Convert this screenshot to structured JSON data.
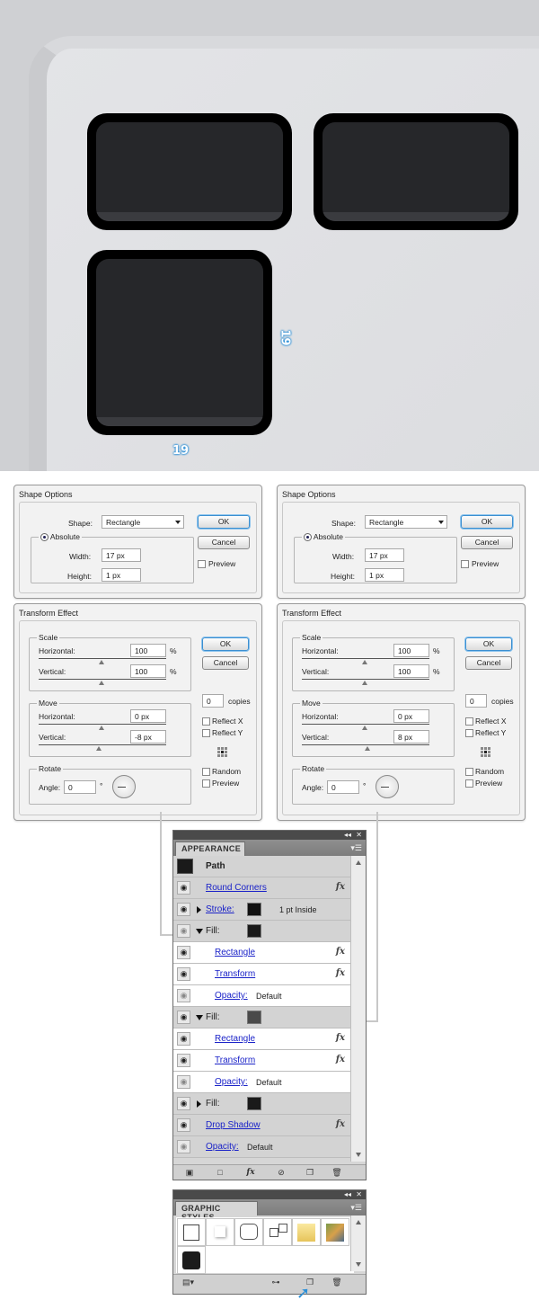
{
  "canvas": {
    "dimension_right": "19",
    "dimension_bottom": "19"
  },
  "shape_options_left": {
    "title": "Shape Options",
    "shape_label": "Shape:",
    "shape_value": "Rectangle",
    "absolute_label": "Absolute",
    "width_label": "Width:",
    "width_value": "17 px",
    "height_label": "Height:",
    "height_value": "1 px",
    "ok": "OK",
    "cancel": "Cancel",
    "preview": "Preview"
  },
  "shape_options_right": {
    "title": "Shape Options",
    "shape_label": "Shape:",
    "shape_value": "Rectangle",
    "absolute_label": "Absolute",
    "width_label": "Width:",
    "width_value": "17 px",
    "height_label": "Height:",
    "height_value": "1 px",
    "ok": "OK",
    "cancel": "Cancel",
    "preview": "Preview"
  },
  "transform_left": {
    "title": "Transform Effect",
    "scale_legend": "Scale",
    "horizontal_label": "Horizontal:",
    "scale_h_value": "100",
    "vertical_label": "Vertical:",
    "scale_v_value": "100",
    "percent": "%",
    "move_legend": "Move",
    "move_h_value": "0 px",
    "move_v_value": "-8 px",
    "rotate_legend": "Rotate",
    "angle_label": "Angle:",
    "angle_value": "0",
    "degree": "°",
    "ok": "OK",
    "cancel": "Cancel",
    "copies_value": "0",
    "copies_label": "copies",
    "reflect_x": "Reflect X",
    "reflect_y": "Reflect Y",
    "random": "Random",
    "preview": "Preview"
  },
  "transform_right": {
    "title": "Transform Effect",
    "scale_legend": "Scale",
    "horizontal_label": "Horizontal:",
    "scale_h_value": "100",
    "vertical_label": "Vertical:",
    "scale_v_value": "100",
    "percent": "%",
    "move_legend": "Move",
    "move_h_value": "0 px",
    "move_v_value": "8 px",
    "rotate_legend": "Rotate",
    "angle_label": "Angle:",
    "angle_value": "0",
    "degree": "°",
    "ok": "OK",
    "cancel": "Cancel",
    "copies_value": "0",
    "copies_label": "copies",
    "reflect_x": "Reflect X",
    "reflect_y": "Reflect Y",
    "random": "Random",
    "preview": "Preview"
  },
  "appearance": {
    "tab": "APPEARANCE",
    "path": "Path",
    "round_corners": "Round Corners",
    "stroke_label": "Stroke:",
    "stroke_value": "1 pt  Inside",
    "fill_label": "Fill:",
    "rectangle": "Rectangle",
    "transform": "Transform",
    "opacity_label": "Opacity:",
    "opacity_value": "Default",
    "drop_shadow": "Drop Shadow",
    "fx": "fx",
    "colors": {
      "fill_1": "#1a1a1a",
      "fill_2": "#4a4a4a",
      "fill_3": "#1a1a1a",
      "stroke": "#111111"
    }
  },
  "graphic_styles": {
    "tab": "GRAPHIC STYLES"
  }
}
